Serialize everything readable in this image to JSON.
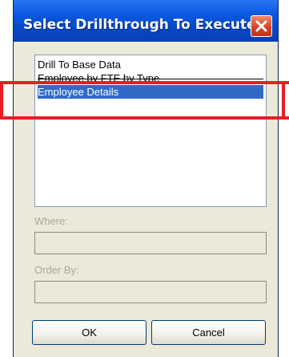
{
  "dialog": {
    "title": "Select Drillthrough To Execute",
    "close_icon": "close-icon"
  },
  "list": {
    "items": [
      {
        "label": "Drill To Base Data",
        "selected": false
      },
      {
        "label": "Employee by FTE by Type",
        "selected": false
      },
      {
        "label": "Employee Details",
        "selected": true
      }
    ]
  },
  "fields": {
    "where_label": "Where:",
    "where_value": "",
    "order_by_label": "Order By:",
    "order_by_value": ""
  },
  "buttons": {
    "ok_label": "OK",
    "cancel_label": "Cancel"
  },
  "colors": {
    "title_bar": "#0a58e0",
    "selection": "#316ac5",
    "highlight": "#ec1c24",
    "close_button": "#d8452a"
  }
}
